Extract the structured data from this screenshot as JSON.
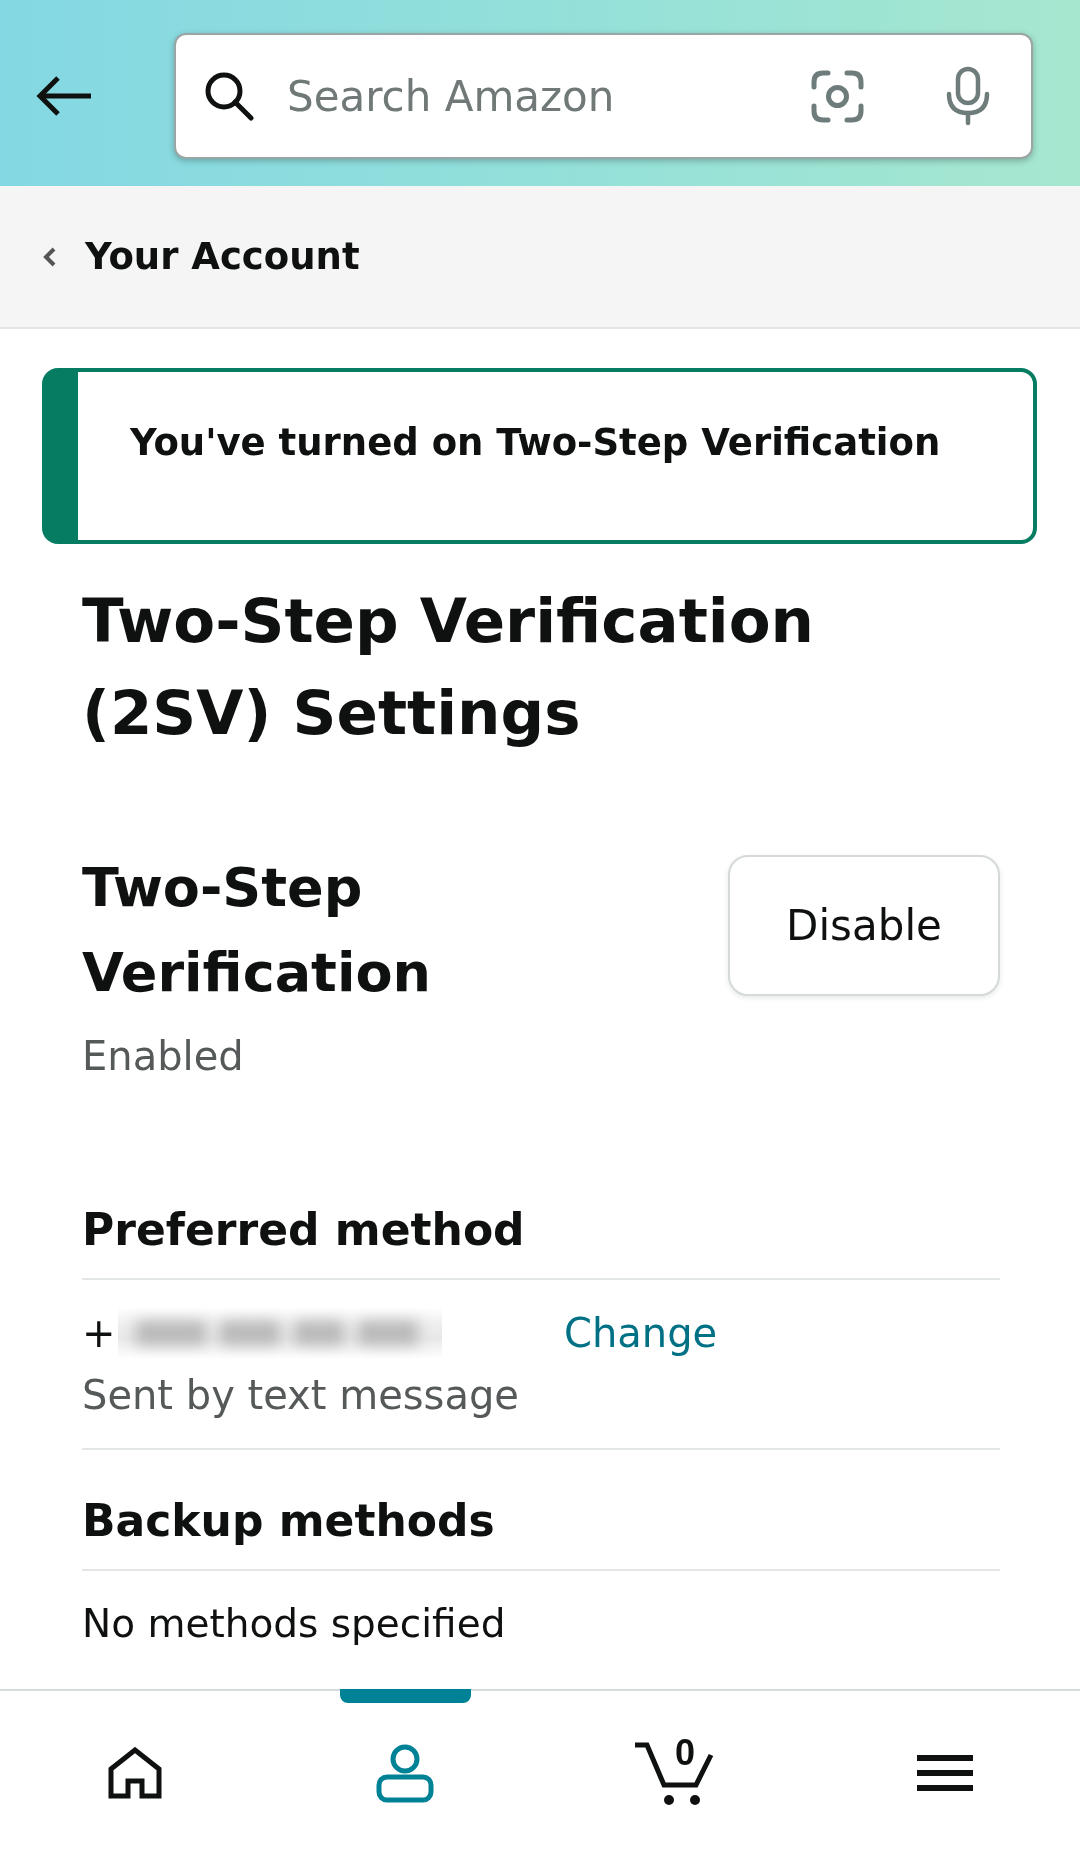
{
  "header": {
    "search": {
      "placeholder": "Search Amazon"
    }
  },
  "breadcrumb": {
    "label": "Your Account"
  },
  "banner": {
    "message": "You've turned on Two-Step Verification"
  },
  "title": "Two-Step Verification (2SV) Settings",
  "status_section": {
    "heading": "Two-Step Verification",
    "status": "Enabled",
    "button": "Disable"
  },
  "preferred_method": {
    "heading": "Preferred method",
    "phone_prefix": "+",
    "action": "Change",
    "detail": "Sent by text message"
  },
  "backup_methods": {
    "heading": "Backup methods",
    "empty_text": "No methods specified"
  },
  "bottom_nav": {
    "items": [
      {
        "kind": "home",
        "selected": false
      },
      {
        "kind": "account",
        "selected": true
      },
      {
        "kind": "cart",
        "selected": false,
        "count": "0"
      },
      {
        "kind": "menu",
        "selected": false
      }
    ]
  }
}
